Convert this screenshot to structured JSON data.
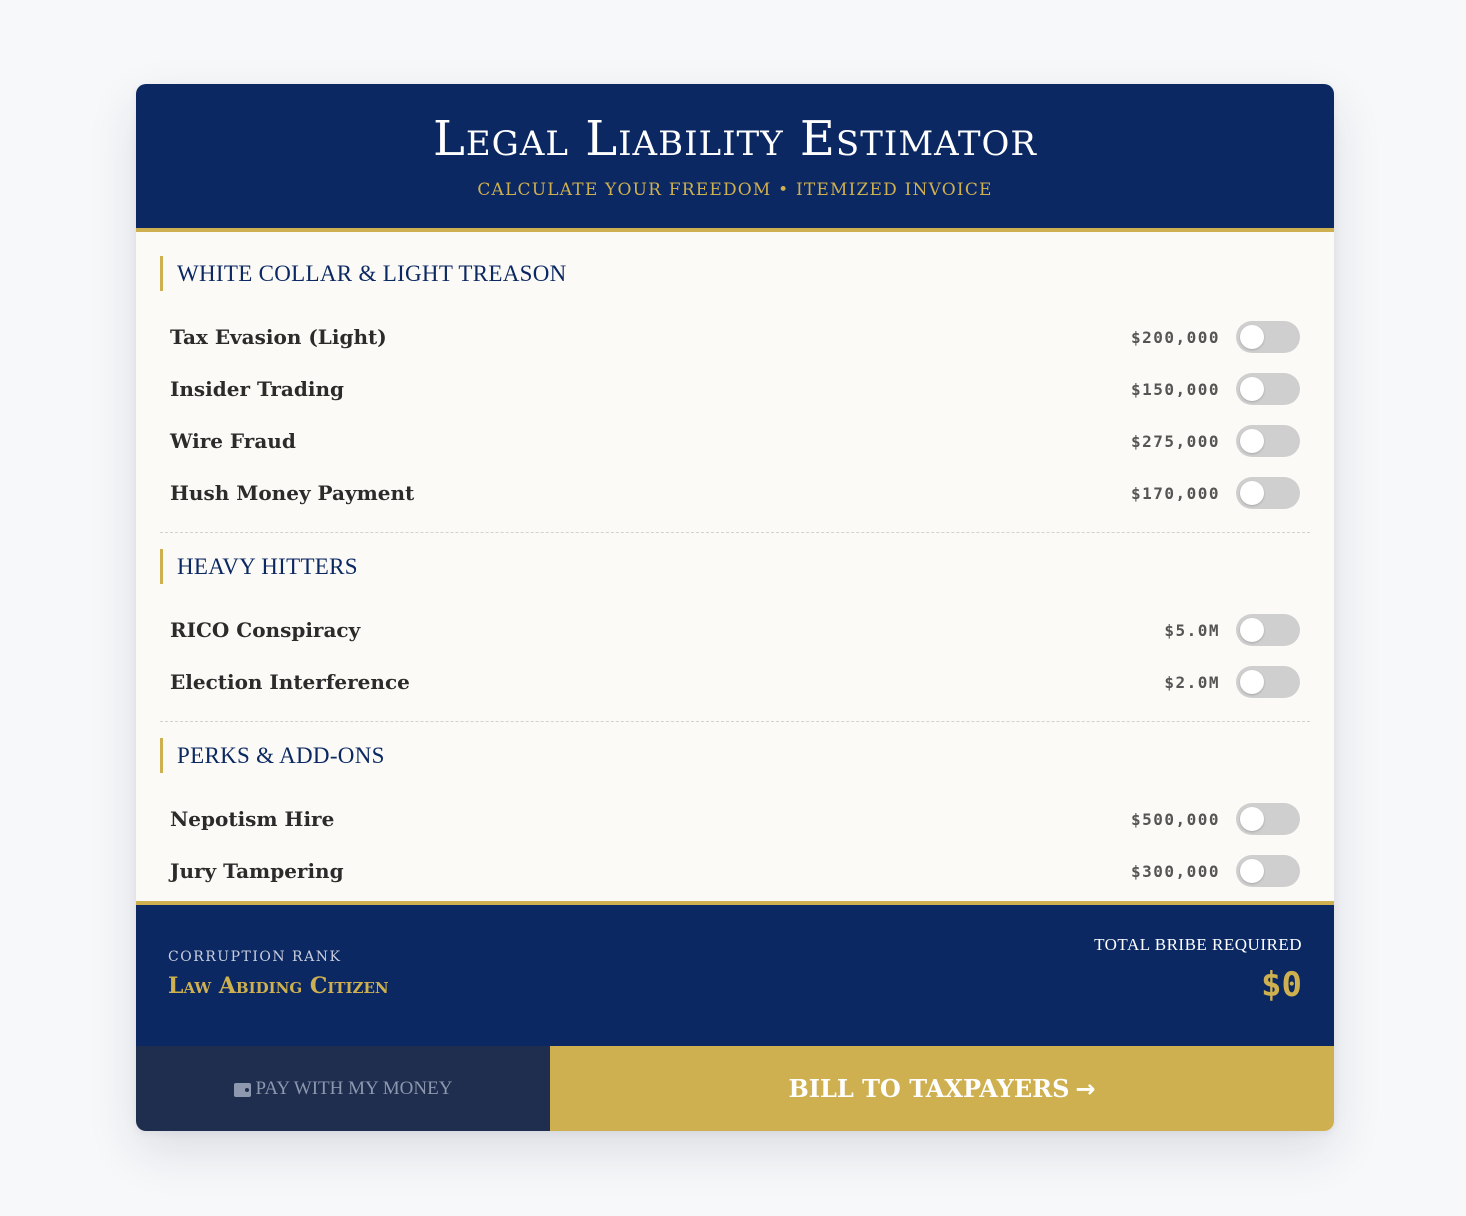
{
  "header": {
    "title": "Legal Liability Estimator",
    "subtitle": "CALCULATE YOUR FREEDOM • ITEMIZED INVOICE"
  },
  "sections": [
    {
      "title": "WHITE COLLAR & LIGHT TREASON",
      "items": [
        {
          "label": "Tax Evasion (Light)",
          "price": "$200,000",
          "enabled": false
        },
        {
          "label": "Insider Trading",
          "price": "$150,000",
          "enabled": false
        },
        {
          "label": "Wire Fraud",
          "price": "$275,000",
          "enabled": false
        },
        {
          "label": "Hush Money Payment",
          "price": "$170,000",
          "enabled": false
        }
      ]
    },
    {
      "title": "HEAVY HITTERS",
      "items": [
        {
          "label": "RICO Conspiracy",
          "price": "$5.0M",
          "enabled": false
        },
        {
          "label": "Election Interference",
          "price": "$2.0M",
          "enabled": false
        }
      ]
    },
    {
      "title": "PERKS & ADD-ONS",
      "items": [
        {
          "label": "Nepotism Hire",
          "price": "$500,000",
          "enabled": false
        },
        {
          "label": "Jury Tampering",
          "price": "$300,000",
          "enabled": false
        }
      ]
    }
  ],
  "summary": {
    "rank_label": "CORRUPTION RANK",
    "rank_value": "Law Abiding Citizen",
    "total_label": "TOTAL BRIBE REQUIRED",
    "total_value": "$0"
  },
  "actions": {
    "own_money_label": "PAY WITH MY MONEY",
    "own_money_icon": "wallet-icon",
    "taxpayers_label": "BILL TO TAXPAYERS",
    "taxpayers_icon": "arrow-right-icon",
    "arrow_glyph": "→"
  },
  "colors": {
    "navy": "#0b2862",
    "gold": "#cfb050",
    "toggle_off": "#cfcfcf"
  }
}
